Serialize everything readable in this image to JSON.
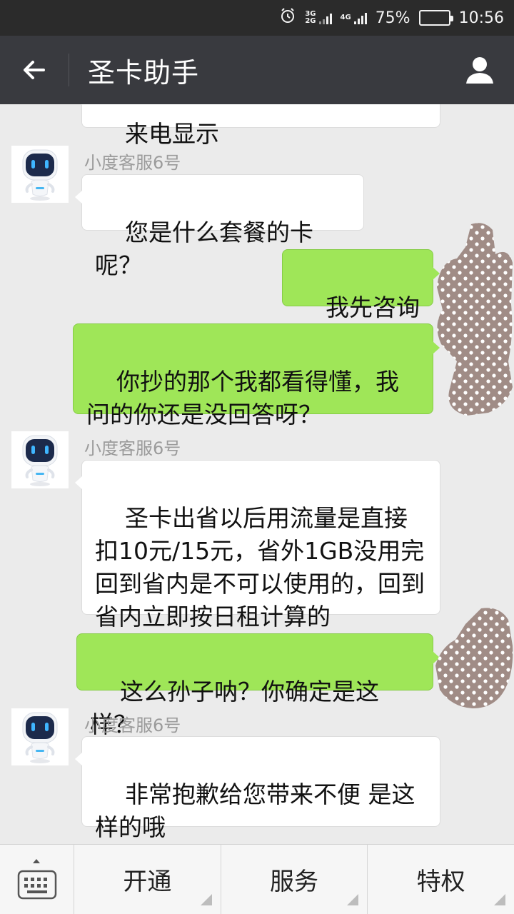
{
  "status_bar": {
    "net_3g": "3G",
    "net_2g": "2G",
    "net_4g": "4G",
    "battery": "75%",
    "battery_level": 0.75,
    "time": "10:56"
  },
  "header": {
    "title": "圣卡助手",
    "back_icon": "arrow-left-icon",
    "profile_icon": "person-icon"
  },
  "messages": {
    "m0": {
      "side": "left",
      "text": "来电显示"
    },
    "m1": {
      "side": "left",
      "sender": "小度客服6号",
      "text": "您是什么套餐的卡呢？"
    },
    "m2": {
      "side": "right",
      "text": "我先咨询啊"
    },
    "m3": {
      "side": "right",
      "text": "你抄的那个我都看得懂，我问的你还是没回答呀？"
    },
    "m4": {
      "side": "left",
      "sender": "小度客服6号",
      "text": "圣卡出省以后用流量是直接扣10元/15元，省外1GB没用完回到省内是不可以使用的，回到省内立即按日租计算的"
    },
    "m5": {
      "side": "right",
      "text": "这么孙子呐？你确定是这样？"
    },
    "m6": {
      "side": "left",
      "sender": "小度客服6号",
      "text": "非常抱歉给您带来不便 是这样的哦"
    }
  },
  "bottom_menu": {
    "keyboard_icon": "keyboard-icon",
    "items": [
      "开通",
      "服务",
      "特权"
    ]
  },
  "colors": {
    "status_bar": "#2b2b2b",
    "title_bar": "#393a3f",
    "chat_bg": "#ebebeb",
    "bubble_sent": "#9fe658",
    "bubble_received": "#ffffff",
    "redaction": "#a08c86"
  }
}
